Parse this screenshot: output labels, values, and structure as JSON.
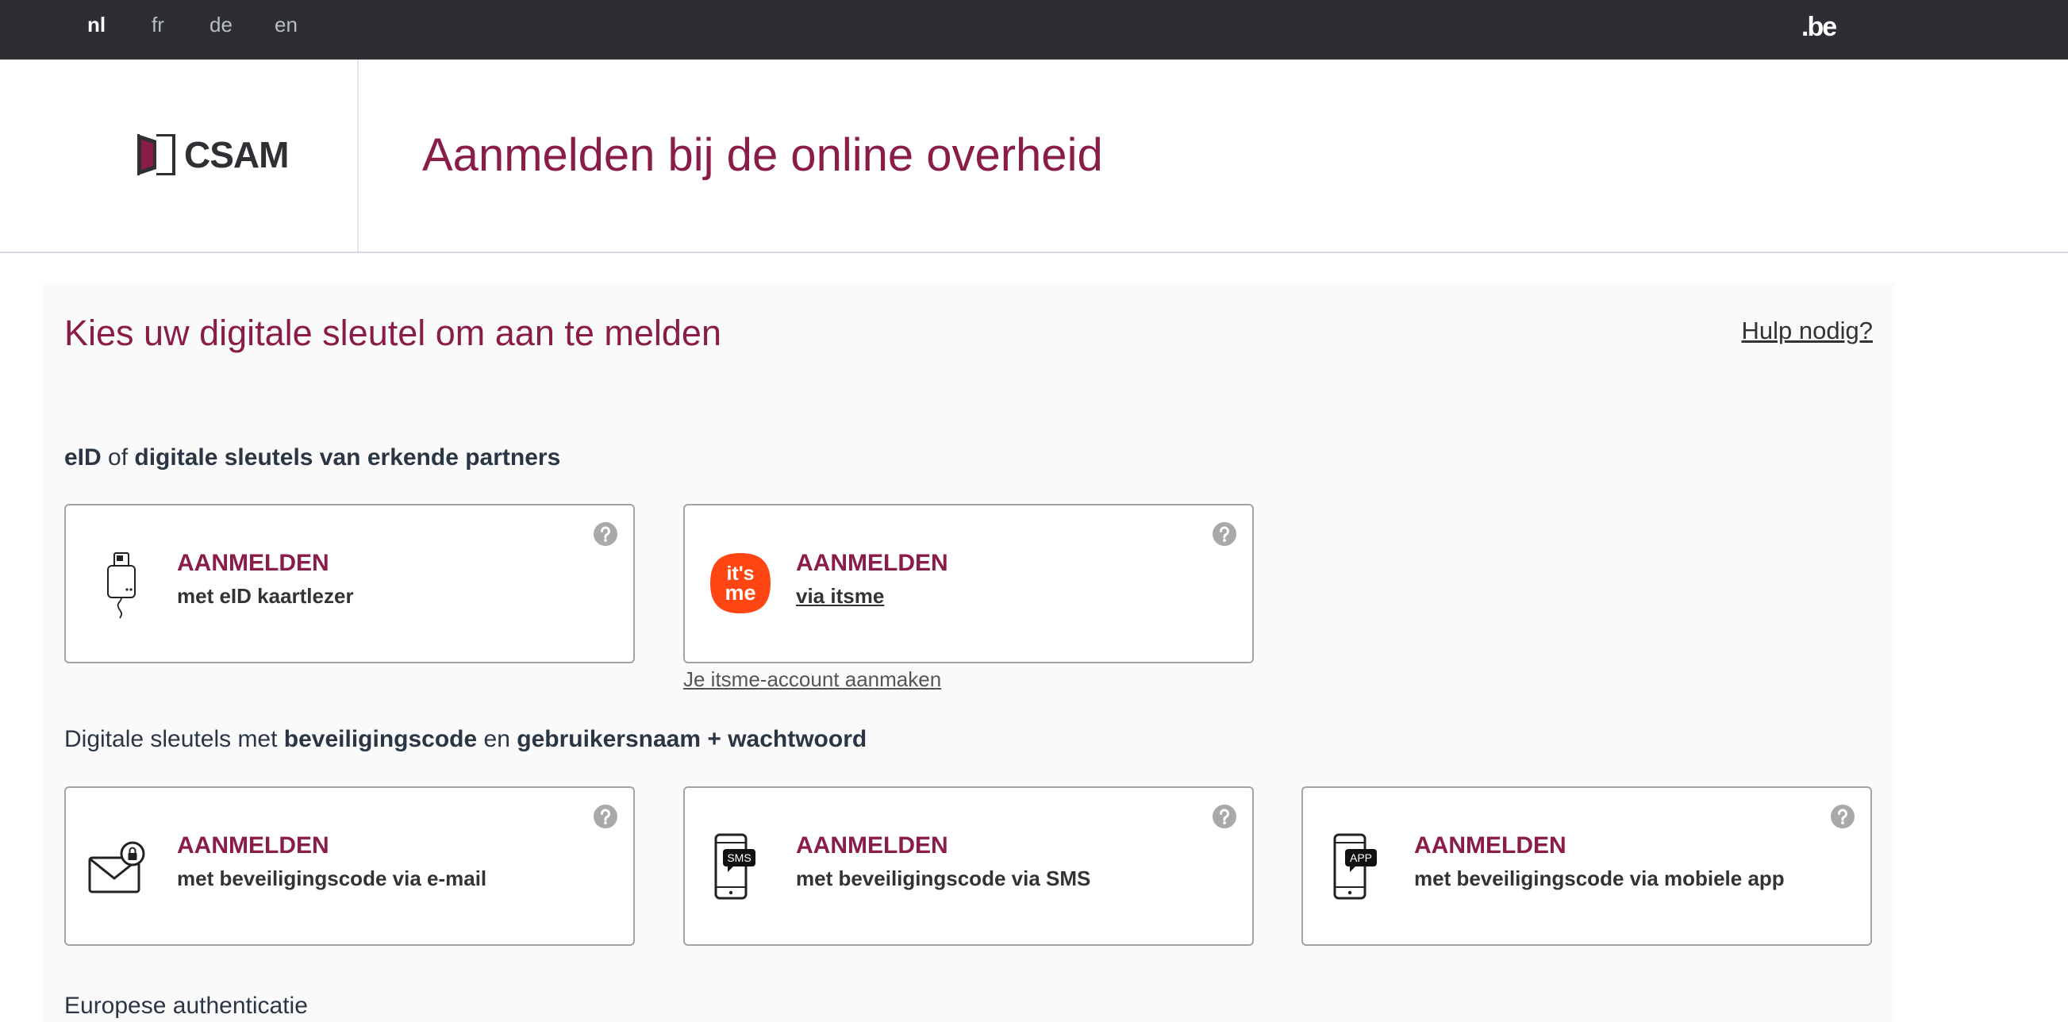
{
  "colors": {
    "accent": "#8a1c48",
    "topbar": "#2c2e33",
    "itsme": "#ff4612"
  },
  "topbar": {
    "languages": [
      {
        "code": "nl",
        "active": true
      },
      {
        "code": "fr",
        "active": false
      },
      {
        "code": "de",
        "active": false
      },
      {
        "code": "en",
        "active": false
      }
    ],
    "brand": ".be"
  },
  "header": {
    "logo_text": "CSAM",
    "title": "Aanmelden bij de online overheid"
  },
  "main": {
    "heading": "Kies uw digitale sleutel om aan te melden",
    "help_link": "Hulp nodig?",
    "sections": [
      {
        "label_parts": [
          "eID",
          " of ",
          "digitale sleutels van erkende partners"
        ],
        "cards": [
          {
            "title": "AANMELDEN",
            "subtitle": "met eID kaartlezer",
            "icon": "eid-card-reader-icon"
          },
          {
            "title": "AANMELDEN",
            "subtitle": "via itsme",
            "icon": "itsme-logo",
            "logo_text": [
              "it's",
              "me"
            ]
          }
        ],
        "link": "Je itsme-account aanmaken"
      },
      {
        "label_parts": [
          "Digitale sleutels met ",
          "beveiligingscode",
          " en ",
          "gebruikersnaam + wachtwoord"
        ],
        "cards": [
          {
            "title": "AANMELDEN",
            "subtitle": "met beveiligingscode via e-mail",
            "icon": "email-lock-icon"
          },
          {
            "title": "AANMELDEN",
            "subtitle": "met beveiligingscode via SMS",
            "icon": "phone-sms-icon",
            "badge": "SMS"
          },
          {
            "title": "AANMELDEN",
            "subtitle": "met beveiligingscode via mobiele app",
            "icon": "phone-app-icon",
            "badge": "APP"
          }
        ]
      }
    ],
    "european_heading": "Europese authenticatie"
  }
}
